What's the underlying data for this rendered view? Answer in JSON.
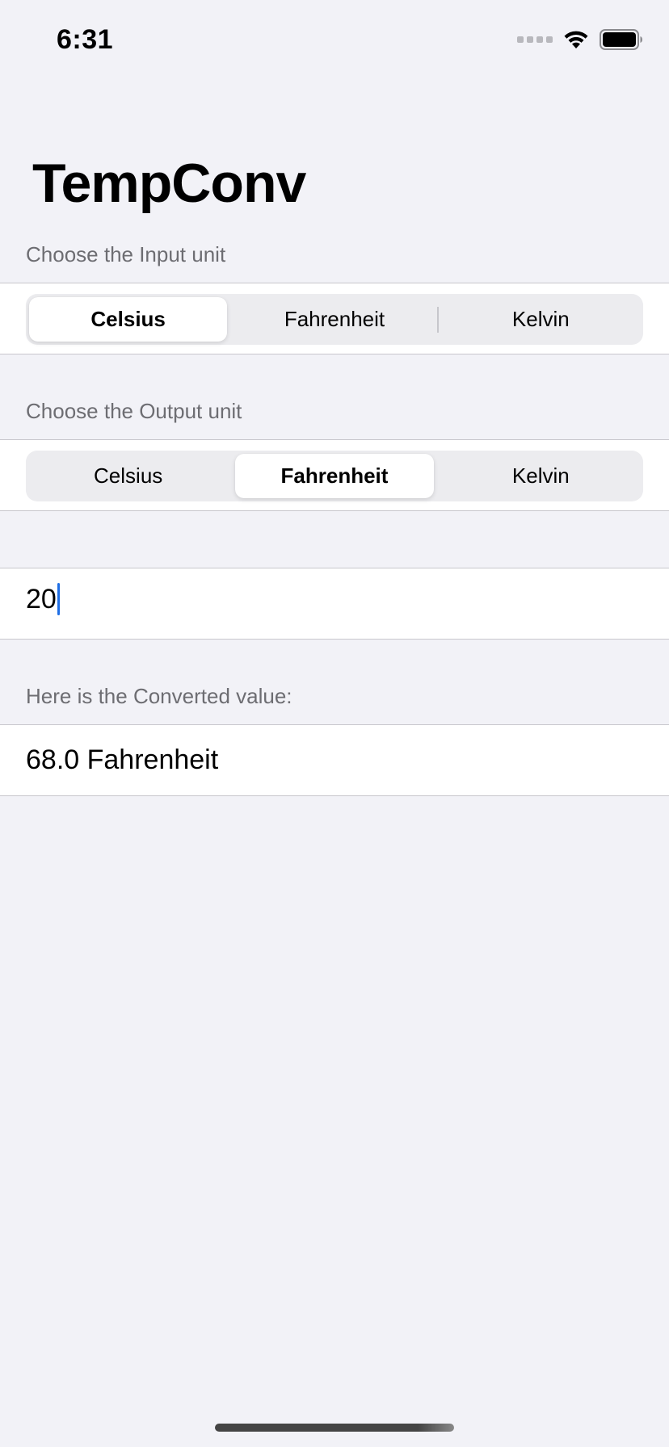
{
  "status_bar": {
    "time": "6:31",
    "icons": [
      "cellular-signal-icon",
      "wifi-icon",
      "battery-icon"
    ]
  },
  "app": {
    "title": "TempConv"
  },
  "input_section": {
    "header": "Choose the Input unit",
    "options": [
      "Celsius",
      "Fahrenheit",
      "Kelvin"
    ],
    "selected": "Celsius"
  },
  "output_section": {
    "header": "Choose the Output unit",
    "options": [
      "Celsius",
      "Fahrenheit",
      "Kelvin"
    ],
    "selected": "Fahrenheit"
  },
  "value_field": {
    "value": "20"
  },
  "result_section": {
    "header": "Here is the Converted value:",
    "value": "68.0 Fahrenheit"
  },
  "colors": {
    "background": "#f2f2f7",
    "caret": "#1f6fe5",
    "section_header": "#6d6d72"
  }
}
